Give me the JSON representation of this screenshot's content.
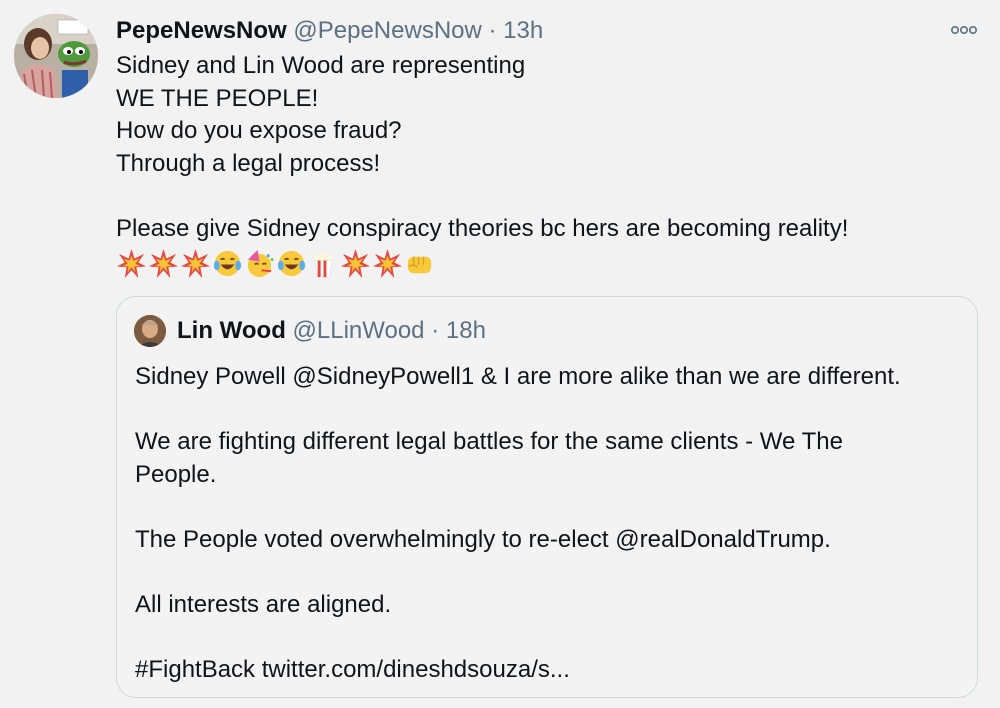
{
  "tweet": {
    "display_name": "PepeNewsNow",
    "handle": "@PepeNewsNow",
    "separator": " · ",
    "time": "13h",
    "lines": [
      "Sidney and Lin Wood are representing",
      "WE THE PEOPLE!",
      "How do you expose fraud?",
      "Through a legal process!"
    ],
    "line_after_gap": "Please give Sidney conspiracy theories bc hers are becoming reality!",
    "emoji_icons": [
      "collision-icon",
      "collision-icon",
      "collision-icon",
      "tears-of-joy-icon",
      "party-face-icon",
      "tears-of-joy-icon",
      "popcorn-icon",
      "collision-icon",
      "collision-icon",
      "oncoming-fist-icon"
    ]
  },
  "quote": {
    "display_name": "Lin Wood",
    "handle": "@LLinWood",
    "separator": " · ",
    "time": "18h",
    "paragraphs": [
      "Sidney Powell @SidneyPowell1 & I are more alike than we are different.",
      "We are fighting different legal battles for the same clients - We The",
      "People.",
      "The People voted overwhelmingly to re-elect @realDonaldTrump.",
      "All interests are aligned.",
      "#FightBack twitter.com/dineshdsouza/s..."
    ]
  },
  "colors": {
    "background": "#f2f2f2",
    "text": "#0f1419",
    "muted": "#5b7083",
    "border": "#cfd9de"
  }
}
